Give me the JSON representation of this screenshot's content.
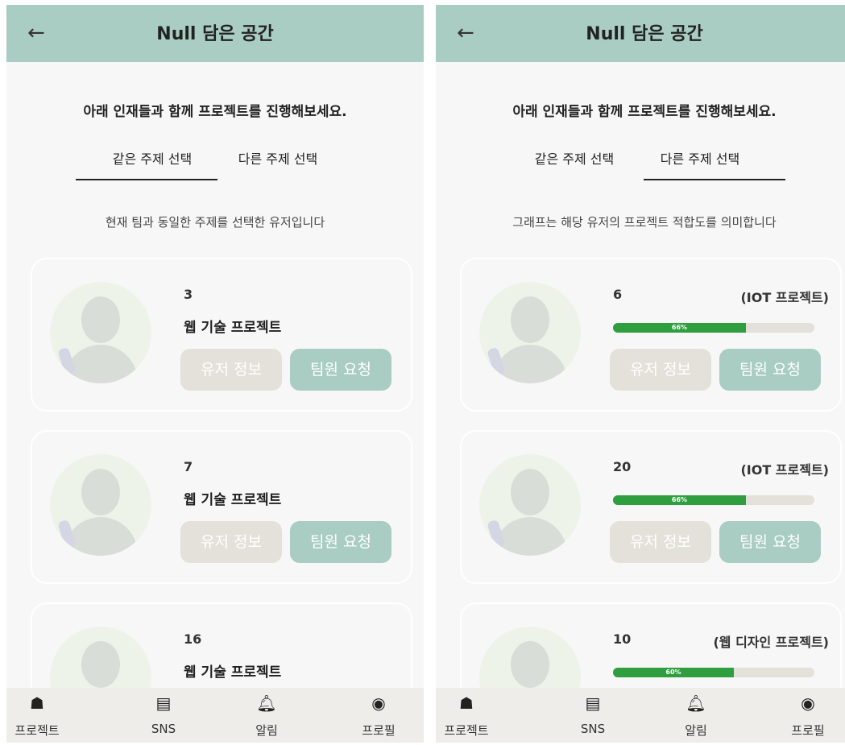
{
  "app": {
    "title": "Null 담은 공간",
    "back_icon": "←"
  },
  "intro": {
    "subtitle": "아래 인재들과 함께 프로젝트를 진행해보세요."
  },
  "tabs": {
    "same": "같은 주제 선택",
    "different": "다른 주제 선택"
  },
  "left_screen": {
    "active_tab": "same",
    "description": "현재 팀과 동일한 주제를 선택한 유저입니다",
    "cards": [
      {
        "user_id": "3",
        "project": "웹 기술 프로젝트"
      },
      {
        "user_id": "7",
        "project": "웹 기술 프로젝트"
      },
      {
        "user_id": "16",
        "project": "웹 기술 프로젝트"
      }
    ]
  },
  "right_screen": {
    "active_tab": "different",
    "description": "그래프는 해당 유저의 프로젝트 적합도를 의미합니다",
    "cards": [
      {
        "user_id": "6",
        "project": "(IOT 프로젝트)",
        "fit_percent": 66,
        "fit_label": "66%"
      },
      {
        "user_id": "20",
        "project": "(IOT 프로젝트)",
        "fit_percent": 66,
        "fit_label": "66%"
      },
      {
        "user_id": "10",
        "project": "(웹 디자인 프로젝트)",
        "fit_percent": 60,
        "fit_label": "60%"
      }
    ]
  },
  "buttons": {
    "user_info": "유저 정보",
    "team_request": "팀원 요청"
  },
  "nav": [
    {
      "label": "프로젝트",
      "icon": "home-icon"
    },
    {
      "label": "SNS",
      "icon": "document-icon"
    },
    {
      "label": "알림",
      "icon": "bell-icon"
    },
    {
      "label": "프로필",
      "icon": "profile-icon"
    }
  ],
  "colors": {
    "header": "#a9cdc2",
    "request_button": "#a9cdc2",
    "info_button": "#e3e1d9",
    "progress": "#2e9e3f",
    "nav_bg": "#efedea"
  }
}
